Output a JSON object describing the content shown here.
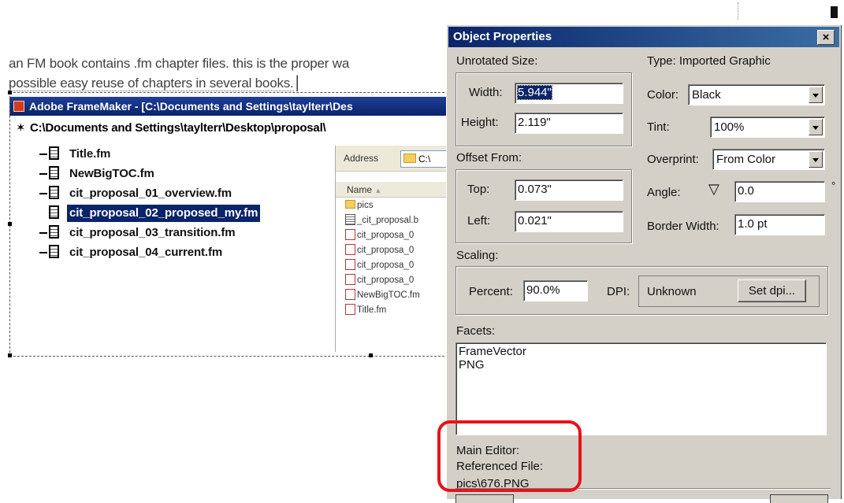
{
  "document": {
    "line1": "an FM book contains .fm chapter files. this is the proper wa",
    "line2": "possible easy reuse of chapters in several books."
  },
  "framemaker_window": {
    "title": "Adobe FrameMaker - [C:\\Documents and Settings\\taylterr\\Des",
    "path": "C:\\Documents and Settings\\taylterr\\Desktop\\proposal\\",
    "files": [
      {
        "name": "Title.fm",
        "selected": false
      },
      {
        "name": "NewBigTOC.fm",
        "selected": false
      },
      {
        "name": "cit_proposal_01_overview.fm",
        "selected": false
      },
      {
        "name": "cit_proposal_02_proposed_my.fm",
        "selected": true
      },
      {
        "name": "cit_proposal_03_transition.fm",
        "selected": false
      },
      {
        "name": "cit_proposal_04_current.fm",
        "selected": false
      }
    ]
  },
  "explorer": {
    "address_label": "Address",
    "address_value": "C:\\",
    "column_name": "Name",
    "items": [
      {
        "name": "pics",
        "icon": "folder-icon"
      },
      {
        "name": "_cit_proposal.b",
        "icon": "book-file-icon"
      },
      {
        "name": "cit_proposa_0",
        "icon": "fm-file-icon"
      },
      {
        "name": "cit_proposa_0",
        "icon": "fm-file-icon"
      },
      {
        "name": "cit_proposa_0",
        "icon": "fm-file-icon"
      },
      {
        "name": "cit_proposa_0",
        "icon": "fm-file-icon"
      },
      {
        "name": "NewBigTOC.fm",
        "icon": "fm-file-icon"
      },
      {
        "name": "Title.fm",
        "icon": "fm-file-icon"
      }
    ]
  },
  "dialog": {
    "title": "Object Properties",
    "close_label": "×",
    "unrotated_size_label": "Unrotated Size:",
    "width_label": "Width:",
    "width_value": "5.944\"",
    "height_label": "Height:",
    "height_value": "2.119\"",
    "type_label": "Type:  Imported Graphic",
    "color_label": "Color:",
    "color_value": "Black",
    "tint_label": "Tint:",
    "tint_value": "100%",
    "offset_label": "Offset From:",
    "top_label": "Top:",
    "top_value": "0.073\"",
    "left_label": "Left:",
    "left_value": "0.021\"",
    "overprint_label": "Overprint:",
    "overprint_value": "From Color",
    "angle_label": "Angle:",
    "angle_value": "0.0",
    "angle_unit": "°",
    "border_label": "Border Width:",
    "border_value": "1.0 pt",
    "scaling_label": "Scaling:",
    "percent_label": "Percent:",
    "percent_value": "90.0%",
    "dpi_label": "DPI:",
    "dpi_value": "Unknown",
    "set_dpi_label": "Set dpi...",
    "facets_label": "Facets:",
    "facets": [
      "FrameVector",
      "PNG"
    ],
    "main_editor_label": "Main Editor:",
    "referenced_file_label": "Referenced File:",
    "referenced_file_value": "pics\\676.PNG"
  },
  "colors": {
    "title_bar": "#0a246a",
    "dialog_bg": "#d4d0c8",
    "highlight_ring": "#e8121a"
  }
}
